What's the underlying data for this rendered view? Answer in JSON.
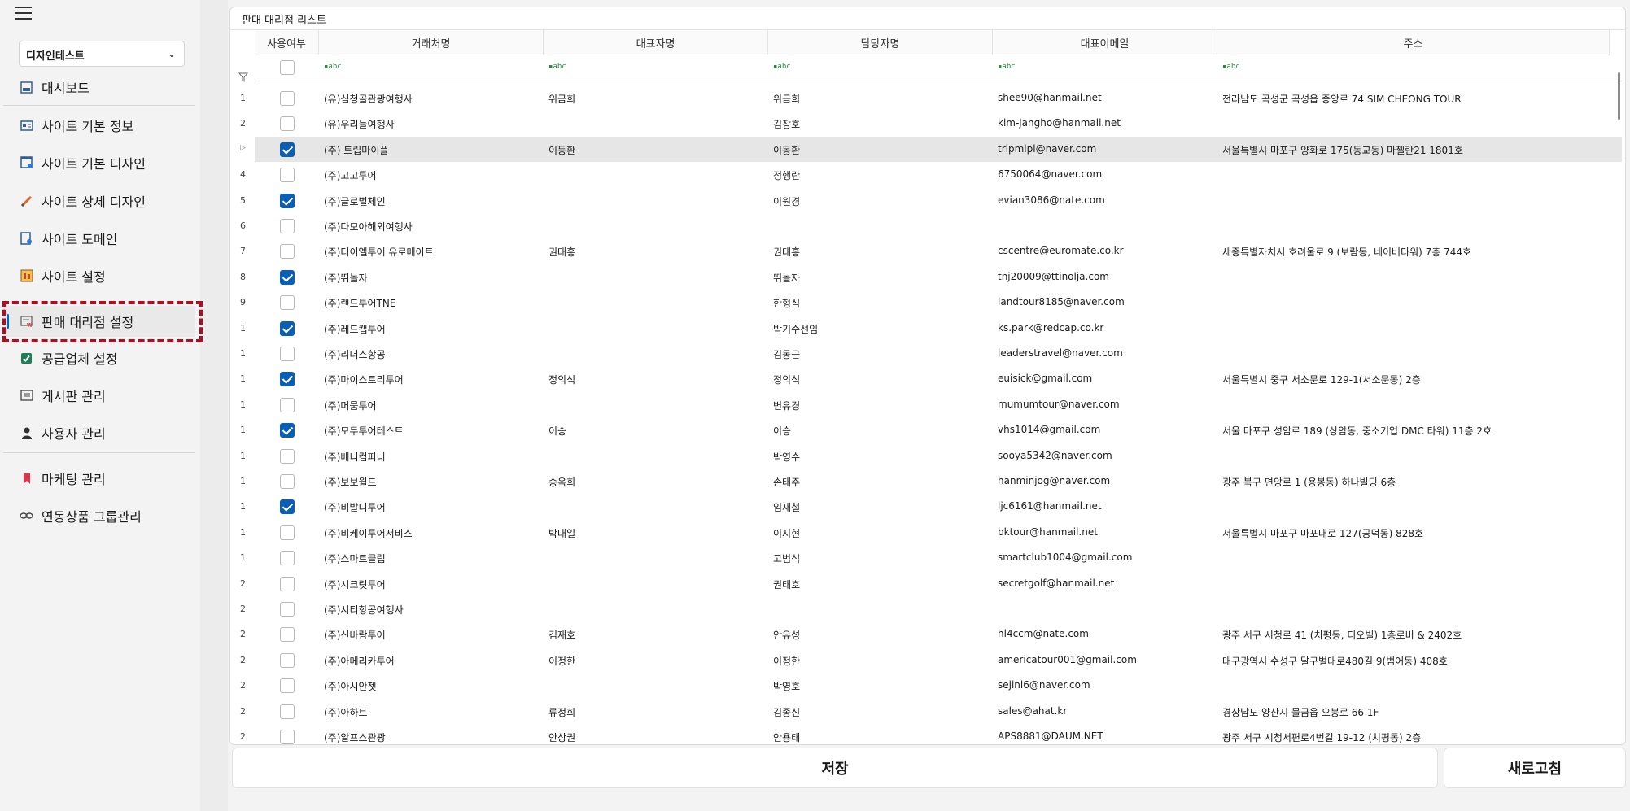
{
  "sidebar": {
    "site_select": "디자인테스트",
    "items": [
      {
        "label": "대시보드",
        "icon": "dashboard-icon"
      },
      {
        "label": "사이트 기본 정보",
        "icon": "id-card-icon"
      },
      {
        "label": "사이트 기본 디자인",
        "icon": "design-icon"
      },
      {
        "label": "사이트 상세 디자인",
        "icon": "pencil-icon"
      },
      {
        "label": "사이트 도메인",
        "icon": "domain-icon"
      },
      {
        "label": "사이트 설정",
        "icon": "settings-icon"
      },
      {
        "label": "판매 대리점 설정",
        "icon": "agency-icon"
      },
      {
        "label": "공급업체 설정",
        "icon": "supplier-check-icon"
      },
      {
        "label": "게시판 관리",
        "icon": "board-icon"
      },
      {
        "label": "사용자 관리",
        "icon": "user-icon"
      },
      {
        "label": "마케팅 관리",
        "icon": "bookmark-icon"
      },
      {
        "label": "연동상품 그룹관리",
        "icon": "link-icon"
      }
    ],
    "selected_index": 6
  },
  "panel": {
    "title": "판대 대리점 리스트"
  },
  "grid": {
    "columns": [
      "사용여부",
      "거래처명",
      "대표자명",
      "담당자명",
      "대표이메일",
      "주소"
    ],
    "filter_glyph": "▪abc",
    "rows": [
      {
        "num": "1",
        "use": false,
        "name": "(유)심청골관광여행사",
        "rep": "위금희",
        "manager": "위금희",
        "email": "shee90@hanmail.net",
        "addr": "전라남도 곡성군 곡성읍 중앙로 74 SIM CHEONG TOUR"
      },
      {
        "num": "2",
        "use": false,
        "name": "(유)우리들여행사",
        "rep": "",
        "manager": "김장호",
        "email": "kim-jangho@hanmail.net",
        "addr": ""
      },
      {
        "num": "",
        "use": true,
        "name": "(주) 트립마이플",
        "rep": "이동환",
        "manager": "이동환",
        "email": "tripmipl@naver.com",
        "addr": "서울특별시 마포구 양화로 175(동교동) 마젤란21 1801호",
        "selected": true
      },
      {
        "num": "4",
        "use": false,
        "name": "(주)고고투어",
        "rep": "",
        "manager": "정행란",
        "email": "6750064@naver.com",
        "addr": ""
      },
      {
        "num": "5",
        "use": true,
        "name": "(주)글로벌체인",
        "rep": "",
        "manager": "이원경",
        "email": "evian3086@nate.com",
        "addr": ""
      },
      {
        "num": "6",
        "use": false,
        "name": "(주)다모아해외여행사",
        "rep": "",
        "manager": "",
        "email": "",
        "addr": ""
      },
      {
        "num": "7",
        "use": false,
        "name": "(주)더이엘투어 유로메이트",
        "rep": "권태흥",
        "manager": "권태흥",
        "email": "cscentre@euromate.co.kr",
        "addr": "세종특별자치시 호려울로 9 (보람동, 네이버타워) 7층 744호"
      },
      {
        "num": "8",
        "use": true,
        "name": "(주)뛰놀자",
        "rep": "",
        "manager": "뛰놀자",
        "email": "tnj20009@ttinolja.com",
        "addr": ""
      },
      {
        "num": "9",
        "use": false,
        "name": "(주)랜드투어TNE",
        "rep": "",
        "manager": "한형식",
        "email": "landtour8185@naver.com",
        "addr": ""
      },
      {
        "num": "1",
        "use": true,
        "name": "(주)레드캡투어",
        "rep": "",
        "manager": "박기수선임",
        "email": "ks.park@redcap.co.kr",
        "addr": ""
      },
      {
        "num": "1",
        "use": false,
        "name": "(주)리더스항공",
        "rep": "",
        "manager": "김동근",
        "email": "leaderstravel@naver.com",
        "addr": ""
      },
      {
        "num": "1",
        "use": true,
        "name": "(주)마이스트리투어",
        "rep": "정의식",
        "manager": "정의식",
        "email": "euisick@gmail.com",
        "addr": "서울특별시 중구 서소문로 129-1(서소문동) 2층"
      },
      {
        "num": "1",
        "use": false,
        "name": "(주)머뭄투어",
        "rep": "",
        "manager": "변유경",
        "email": "mumumtour@naver.com",
        "addr": ""
      },
      {
        "num": "1",
        "use": true,
        "name": "(주)모두투어테스트",
        "rep": "이승",
        "manager": "이승",
        "email": "vhs1014@gmail.com",
        "addr": "서울 마포구 성암로 189 (상암동, 중소기업 DMC 타워) 11층 2호"
      },
      {
        "num": "1",
        "use": false,
        "name": "(주)베니컴퍼니",
        "rep": "",
        "manager": "박영수",
        "email": "sooya5342@naver.com",
        "addr": ""
      },
      {
        "num": "1",
        "use": false,
        "name": "(주)보보월드",
        "rep": "송옥희",
        "manager": "손태주",
        "email": "hanminjog@naver.com",
        "addr": "광주 북구 면앙로 1 (용봉동) 하나빌딩 6층"
      },
      {
        "num": "1",
        "use": true,
        "name": "(주)비발디투어",
        "rep": "",
        "manager": "임재철",
        "email": "ljc6161@hanmail.net",
        "addr": ""
      },
      {
        "num": "1",
        "use": false,
        "name": "(주)비케이투어서비스",
        "rep": "박대일",
        "manager": "이지현",
        "email": "bktour@hanmail.net",
        "addr": "서울특별시 마포구 마포대로 127(공덕동) 828호"
      },
      {
        "num": "1",
        "use": false,
        "name": "(주)스마트클럽",
        "rep": "",
        "manager": "고범석",
        "email": "smartclub1004@gmail.com",
        "addr": ""
      },
      {
        "num": "2",
        "use": false,
        "name": "(주)시크릿투어",
        "rep": "",
        "manager": "권태호",
        "email": "secretgolf@hanmail.net",
        "addr": ""
      },
      {
        "num": "2",
        "use": false,
        "name": "(주)시티항공여행사",
        "rep": "",
        "manager": "",
        "email": "",
        "addr": ""
      },
      {
        "num": "2",
        "use": false,
        "name": "(주)신바람투어",
        "rep": "김재호",
        "manager": "안유성",
        "email": "hl4ccm@nate.com",
        "addr": "광주 서구 시청로 41 (치평동, 디오빌) 1층로비 & 2402호"
      },
      {
        "num": "2",
        "use": false,
        "name": "(주)아메리카투어",
        "rep": "이정한",
        "manager": "이정한",
        "email": "americatour001@gmail.com",
        "addr": "대구광역시 수성구 달구벌대로480길 9(범어동) 408호"
      },
      {
        "num": "2",
        "use": false,
        "name": "(주)아시안젯",
        "rep": "",
        "manager": "박영호",
        "email": "sejini6@naver.com",
        "addr": ""
      },
      {
        "num": "2",
        "use": false,
        "name": "(주)아하트",
        "rep": "류정희",
        "manager": "김종신",
        "email": "sales@ahat.kr",
        "addr": "경상남도 양산시 물금읍 오봉로 66 1F"
      },
      {
        "num": "2",
        "use": false,
        "name": "(주)알프스관광",
        "rep": "안상권",
        "manager": "안용태",
        "email": "APS8881@DAUM.NET",
        "addr": "광주 서구 시청서편로4번길 19-12 (치평동) 2층"
      }
    ]
  },
  "buttons": {
    "save": "저장",
    "refresh": "새로고침"
  },
  "colors": {
    "accent": "#0a5fb4",
    "highlight": "#b20d1f"
  }
}
